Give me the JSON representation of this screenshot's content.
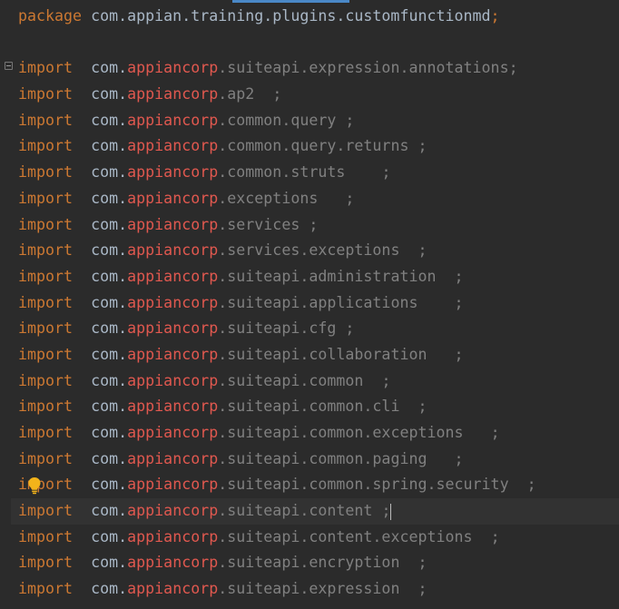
{
  "package_line": {
    "keyword": "package",
    "name": "com.appian.training.plugins.customfunctionmd",
    "terminator": ";"
  },
  "imports": [
    {
      "keyword": "import",
      "prefix": "com.",
      "vendor": "appiancorp",
      "rest": ".suiteapi.expression.annotations",
      "spacing": "",
      "semi": ";"
    },
    {
      "keyword": "import",
      "prefix": "com.",
      "vendor": "appiancorp",
      "rest": ".ap2",
      "spacing": "  ",
      "semi": ";"
    },
    {
      "keyword": "import",
      "prefix": "com.",
      "vendor": "appiancorp",
      "rest": ".common.query",
      "spacing": " ",
      "semi": ";"
    },
    {
      "keyword": "import",
      "prefix": "com.",
      "vendor": "appiancorp",
      "rest": ".common.query.returns",
      "spacing": " ",
      "semi": ";"
    },
    {
      "keyword": "import",
      "prefix": "com.",
      "vendor": "appiancorp",
      "rest": ".common.struts",
      "spacing": "    ",
      "semi": ";"
    },
    {
      "keyword": "import",
      "prefix": "com.",
      "vendor": "appiancorp",
      "rest": ".exceptions",
      "spacing": "   ",
      "semi": ";"
    },
    {
      "keyword": "import",
      "prefix": "com.",
      "vendor": "appiancorp",
      "rest": ".services",
      "spacing": " ",
      "semi": ";"
    },
    {
      "keyword": "import",
      "prefix": "com.",
      "vendor": "appiancorp",
      "rest": ".services.exceptions",
      "spacing": "  ",
      "semi": ";"
    },
    {
      "keyword": "import",
      "prefix": "com.",
      "vendor": "appiancorp",
      "rest": ".suiteapi.administration",
      "spacing": "  ",
      "semi": ";"
    },
    {
      "keyword": "import",
      "prefix": "com.",
      "vendor": "appiancorp",
      "rest": ".suiteapi.applications",
      "spacing": "    ",
      "semi": ";"
    },
    {
      "keyword": "import",
      "prefix": "com.",
      "vendor": "appiancorp",
      "rest": ".suiteapi.cfg",
      "spacing": " ",
      "semi": ";"
    },
    {
      "keyword": "import",
      "prefix": "com.",
      "vendor": "appiancorp",
      "rest": ".suiteapi.collaboration",
      "spacing": "   ",
      "semi": ";"
    },
    {
      "keyword": "import",
      "prefix": "com.",
      "vendor": "appiancorp",
      "rest": ".suiteapi.common",
      "spacing": "  ",
      "semi": ";"
    },
    {
      "keyword": "import",
      "prefix": "com.",
      "vendor": "appiancorp",
      "rest": ".suiteapi.common.cli",
      "spacing": "  ",
      "semi": ";"
    },
    {
      "keyword": "import",
      "prefix": "com.",
      "vendor": "appiancorp",
      "rest": ".suiteapi.common.exceptions",
      "spacing": "   ",
      "semi": ";"
    },
    {
      "keyword": "import",
      "prefix": "com.",
      "vendor": "appiancorp",
      "rest": ".suiteapi.common.paging",
      "spacing": "   ",
      "semi": ";"
    },
    {
      "keyword": "import",
      "prefix": "com.",
      "vendor": "appiancorp",
      "rest": ".suiteapi.common.spring.security",
      "spacing": "  ",
      "semi": ";"
    },
    {
      "keyword": "import",
      "prefix": "com.",
      "vendor": "appiancorp",
      "rest": ".suiteapi.content",
      "spacing": " ",
      "semi": ";"
    },
    {
      "keyword": "import",
      "prefix": "com.",
      "vendor": "appiancorp",
      "rest": ".suiteapi.content.exceptions",
      "spacing": "  ",
      "semi": ";"
    },
    {
      "keyword": "import",
      "prefix": "com.",
      "vendor": "appiancorp",
      "rest": ".suiteapi.encryption",
      "spacing": "  ",
      "semi": ";"
    },
    {
      "keyword": "import",
      "prefix": "com.",
      "vendor": "appiancorp",
      "rest": ".suiteapi.expression",
      "spacing": "  ",
      "semi": ";"
    }
  ],
  "caret_line_index": 17,
  "icons": {
    "fold": "fold-collapse-icon",
    "intention": "lightbulb-icon"
  },
  "colors": {
    "background": "#2b2b2b",
    "keyword": "#cc7832",
    "identifier": "#a9b7c6",
    "vendor_highlight": "#e0584f",
    "dim_text": "#808080",
    "tab_indicator": "#4a88c7",
    "bulb": "#f2b31a"
  }
}
